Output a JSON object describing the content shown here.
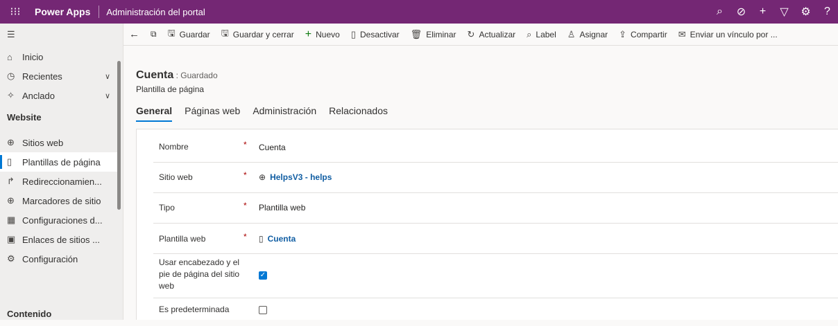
{
  "topbar": {
    "brand": "Power Apps",
    "app_title": "Administración del portal",
    "icons": [
      "search-icon",
      "target-icon",
      "plus-icon",
      "filter-icon",
      "gear-icon",
      "help-icon"
    ]
  },
  "sidebar": {
    "items": [
      {
        "label": "Inicio",
        "icon": "home-icon"
      },
      {
        "label": "Recientes",
        "icon": "clock-icon"
      },
      {
        "label": "Anclado",
        "icon": "pin-icon"
      }
    ],
    "section_website": "Website",
    "website_items": [
      {
        "label": "Sitios web",
        "icon": "globe-icon"
      },
      {
        "label": "Plantillas de página",
        "icon": "page-icon",
        "selected": true
      },
      {
        "label": "Redireccionamien...",
        "icon": "redirect-icon"
      },
      {
        "label": "Marcadores de sitio",
        "icon": "globe-icon"
      },
      {
        "label": "Configuraciones d...",
        "icon": "settings-table-icon"
      },
      {
        "label": "Enlaces de sitios ...",
        "icon": "link-page-icon"
      },
      {
        "label": "Configuración",
        "icon": "gear-icon"
      }
    ],
    "section_content": "Contenido"
  },
  "commandbar": {
    "items": [
      {
        "label": "Guardar",
        "icon": "save-icon"
      },
      {
        "label": "Guardar y cerrar",
        "icon": "save-close-icon"
      },
      {
        "label": "Nuevo",
        "icon": "plus-icon"
      },
      {
        "label": "Desactivar",
        "icon": "deactivate-icon"
      },
      {
        "label": "Eliminar",
        "icon": "trash-icon"
      },
      {
        "label": "Actualizar",
        "icon": "refresh-icon"
      },
      {
        "label": "Label",
        "icon": "tag-icon"
      },
      {
        "label": "Asignar",
        "icon": "assign-icon"
      },
      {
        "label": "Compartir",
        "icon": "share-icon"
      },
      {
        "label": "Enviar un vínculo por ...",
        "icon": "mail-link-icon"
      }
    ]
  },
  "record": {
    "title": "Cuenta",
    "status": ": Guardado",
    "entity": "Plantilla de página"
  },
  "tabs": [
    "General",
    "Páginas web",
    "Administración",
    "Relacionados"
  ],
  "form": {
    "required_mark": "*",
    "nombre_label": "Nombre",
    "nombre_value": "Cuenta",
    "sitio_label": "Sitio web",
    "sitio_value": "HelpsV3 - helps",
    "tipo_label": "Tipo",
    "tipo_value": "Plantilla web",
    "plantilla_label": "Plantilla web",
    "plantilla_value": "Cuenta",
    "usar_label": "Usar encabezado y el pie de página del sitio web",
    "usar_checked": true,
    "pred_label": "Es predeterminada",
    "pred_checked": false
  }
}
